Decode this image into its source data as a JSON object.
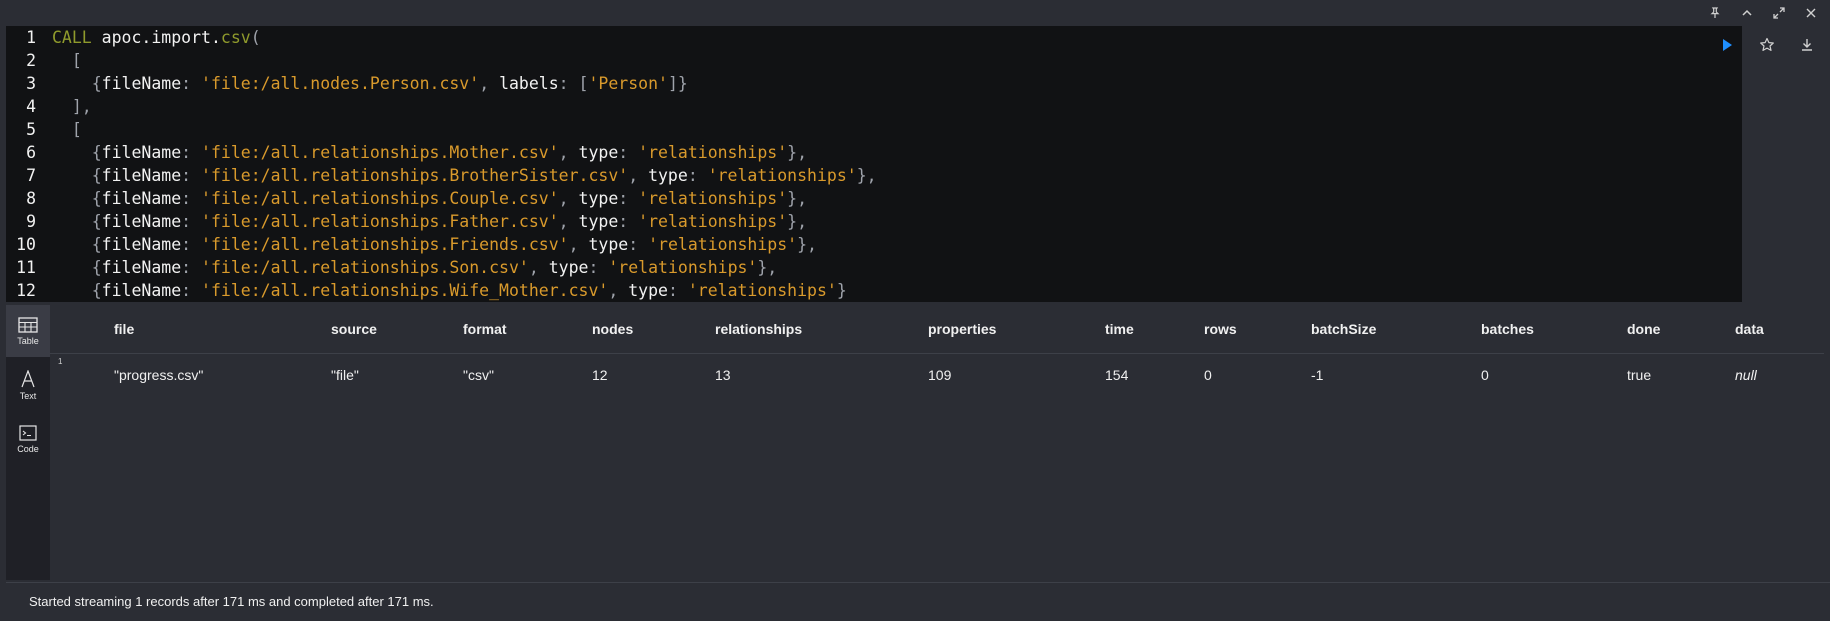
{
  "window_controls": [
    {
      "name": "pin-icon"
    },
    {
      "name": "chevron-up-icon"
    },
    {
      "name": "expand-icon"
    },
    {
      "name": "close-icon"
    }
  ],
  "editor": {
    "lines": [
      {
        "num": "1",
        "segments": [
          [
            "kw",
            "CALL "
          ],
          [
            "fn",
            "apoc.import."
          ],
          [
            "kw",
            "csv"
          ],
          [
            "punc",
            "("
          ]
        ]
      },
      {
        "num": "2",
        "segments": [
          [
            "punc",
            "  ["
          ]
        ]
      },
      {
        "num": "3",
        "segments": [
          [
            "punc",
            "    {"
          ],
          [
            "pr",
            "fileName"
          ],
          [
            "punc",
            ": "
          ],
          [
            "str",
            "'file:/all.nodes.Person.csv'"
          ],
          [
            "punc",
            ", "
          ],
          [
            "pr",
            "labels"
          ],
          [
            "punc",
            ": "
          ],
          [
            "punc",
            "["
          ],
          [
            "str",
            "'Person'"
          ],
          [
            "punc",
            "]}"
          ]
        ]
      },
      {
        "num": "4",
        "segments": [
          [
            "punc",
            "  ],"
          ]
        ]
      },
      {
        "num": "5",
        "segments": [
          [
            "punc",
            "  ["
          ]
        ]
      },
      {
        "num": "6",
        "segments": [
          [
            "punc",
            "    {"
          ],
          [
            "pr",
            "fileName"
          ],
          [
            "punc",
            ": "
          ],
          [
            "str",
            "'file:/all.relationships.Mother.csv'"
          ],
          [
            "punc",
            ", "
          ],
          [
            "pr",
            "type"
          ],
          [
            "punc",
            ": "
          ],
          [
            "str",
            "'relationships'"
          ],
          [
            "punc",
            "},"
          ]
        ]
      },
      {
        "num": "7",
        "segments": [
          [
            "punc",
            "    {"
          ],
          [
            "pr",
            "fileName"
          ],
          [
            "punc",
            ": "
          ],
          [
            "str",
            "'file:/all.relationships.BrotherSister.csv'"
          ],
          [
            "punc",
            ", "
          ],
          [
            "pr",
            "type"
          ],
          [
            "punc",
            ": "
          ],
          [
            "str",
            "'relationships'"
          ],
          [
            "punc",
            "},"
          ]
        ]
      },
      {
        "num": "8",
        "segments": [
          [
            "punc",
            "    {"
          ],
          [
            "pr",
            "fileName"
          ],
          [
            "punc",
            ": "
          ],
          [
            "str",
            "'file:/all.relationships.Couple.csv'"
          ],
          [
            "punc",
            ", "
          ],
          [
            "pr",
            "type"
          ],
          [
            "punc",
            ": "
          ],
          [
            "str",
            "'relationships'"
          ],
          [
            "punc",
            "},"
          ]
        ]
      },
      {
        "num": "9",
        "segments": [
          [
            "punc",
            "    {"
          ],
          [
            "pr",
            "fileName"
          ],
          [
            "punc",
            ": "
          ],
          [
            "str",
            "'file:/all.relationships.Father.csv'"
          ],
          [
            "punc",
            ", "
          ],
          [
            "pr",
            "type"
          ],
          [
            "punc",
            ": "
          ],
          [
            "str",
            "'relationships'"
          ],
          [
            "punc",
            "},"
          ]
        ]
      },
      {
        "num": "10",
        "segments": [
          [
            "punc",
            "    {"
          ],
          [
            "pr",
            "fileName"
          ],
          [
            "punc",
            ": "
          ],
          [
            "str",
            "'file:/all.relationships.Friends.csv'"
          ],
          [
            "punc",
            ", "
          ],
          [
            "pr",
            "type"
          ],
          [
            "punc",
            ": "
          ],
          [
            "str",
            "'relationships'"
          ],
          [
            "punc",
            "},"
          ]
        ]
      },
      {
        "num": "11",
        "segments": [
          [
            "punc",
            "    {"
          ],
          [
            "pr",
            "fileName"
          ],
          [
            "punc",
            ": "
          ],
          [
            "str",
            "'file:/all.relationships.Son.csv'"
          ],
          [
            "punc",
            ", "
          ],
          [
            "pr",
            "type"
          ],
          [
            "punc",
            ": "
          ],
          [
            "str",
            "'relationships'"
          ],
          [
            "punc",
            "},"
          ]
        ]
      },
      {
        "num": "12",
        "segments": [
          [
            "punc",
            "    {"
          ],
          [
            "pr",
            "fileName"
          ],
          [
            "punc",
            ": "
          ],
          [
            "str",
            "'file:/all.relationships.Wife_Mother.csv'"
          ],
          [
            "punc",
            ", "
          ],
          [
            "pr",
            "type"
          ],
          [
            "punc",
            ": "
          ],
          [
            "str",
            "'relationships'"
          ],
          [
            "punc",
            "}"
          ]
        ]
      }
    ],
    "colors": {
      "run": "#1f8fff",
      "keyword": "#8f9a2c",
      "string": "#d99a2c"
    }
  },
  "modes": [
    {
      "label": "Table",
      "icon": "table-icon",
      "active": true
    },
    {
      "label": "Text",
      "icon": "text-icon",
      "active": false
    },
    {
      "label": "Code",
      "icon": "code-icon",
      "active": false
    }
  ],
  "table": {
    "columns": [
      "file",
      "source",
      "format",
      "nodes",
      "relationships",
      "properties",
      "time",
      "rows",
      "batchSize",
      "batches",
      "done",
      "data"
    ],
    "rows": [
      {
        "num": "1",
        "cells": [
          "\"progress.csv\"",
          "\"file\"",
          "\"csv\"",
          "12",
          "13",
          "109",
          "154",
          "0",
          "-1",
          "0",
          "true",
          "null"
        ]
      }
    ]
  },
  "status": "Started streaming 1 records after 171 ms and completed after 171 ms."
}
